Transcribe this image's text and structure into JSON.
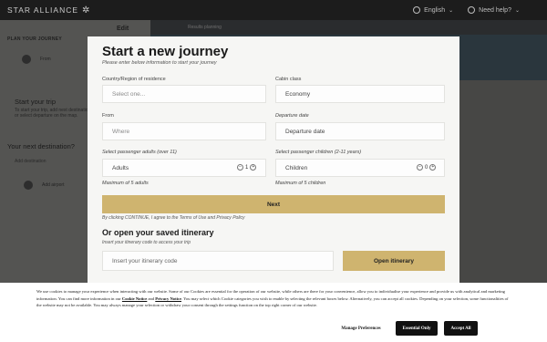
{
  "header": {
    "brand": "STAR ALLIANCE",
    "language": "English",
    "help": "Need help?"
  },
  "sidebar": {
    "title": "PLAN YOUR JOURNEY",
    "edit": "Edit",
    "from_label": "From",
    "start_title": "Start your trip",
    "start_desc": "To start your trip, add next destinations or select departure on the map.",
    "next_title": "Your next destination?",
    "add_label": "Add destination",
    "airport_label": "Add airport"
  },
  "map": {
    "tab_label": "Results planning"
  },
  "modal": {
    "title": "Start a new journey",
    "subtitle": "Please enter below information to start your journey",
    "country_label": "Country/Region of residence",
    "country_placeholder": "Select one...",
    "cabin_label": "Cabin class",
    "cabin_value": "Economy",
    "from_label": "From",
    "from_placeholder": "Where",
    "date_label": "Departure date",
    "date_placeholder": "Departure date",
    "adults_label": "Select passenger adults (over 11)",
    "adults_name": "Adults",
    "adults_count": "1",
    "children_label": "Select passenger children (2-11 years)",
    "children_name": "Children",
    "children_count": "0",
    "max_adults": "Maximum of 5 adults",
    "max_children": "Maximum of 5 children",
    "next_button": "Next",
    "terms": "By clicking CONTINUE, I agree to the Terms of Use and Privacy Policy",
    "saved_title": "Or open your saved itinerary",
    "saved_subtitle": "Insert your itinerary code to access your trip",
    "code_placeholder": "Insert your itinerary code",
    "open_button": "Open itinerary"
  },
  "cookie": {
    "text_a": "We use cookies to manage your experience when interacting with our website. Some of our Cookies are essential for the operation of our website, while others are there for your convenience, allow you to individualise your experience and provide us with analytical and marketing information. You can find more information in our ",
    "cookie_notice": "Cookie Notice",
    "and": " and ",
    "privacy_notice": "Privacy Notice",
    "text_b": ". You may select which Cookie categories you wish to enable by selecting the relevant boxes below. Alternatively, you can accept all cookies. Depending on your selection, some functionalities of the website may not be available. You may always manage your selection or withdraw your consent through the settings function on the top right corner of our website.",
    "manage_button": "Manage Preferences",
    "essential_button": "Essential Only",
    "accept_button": "Accept All"
  },
  "colors": {
    "accent_gold": "#cfb46f",
    "topbar": "#1c1c1c",
    "overlay": "#4a4a48"
  }
}
